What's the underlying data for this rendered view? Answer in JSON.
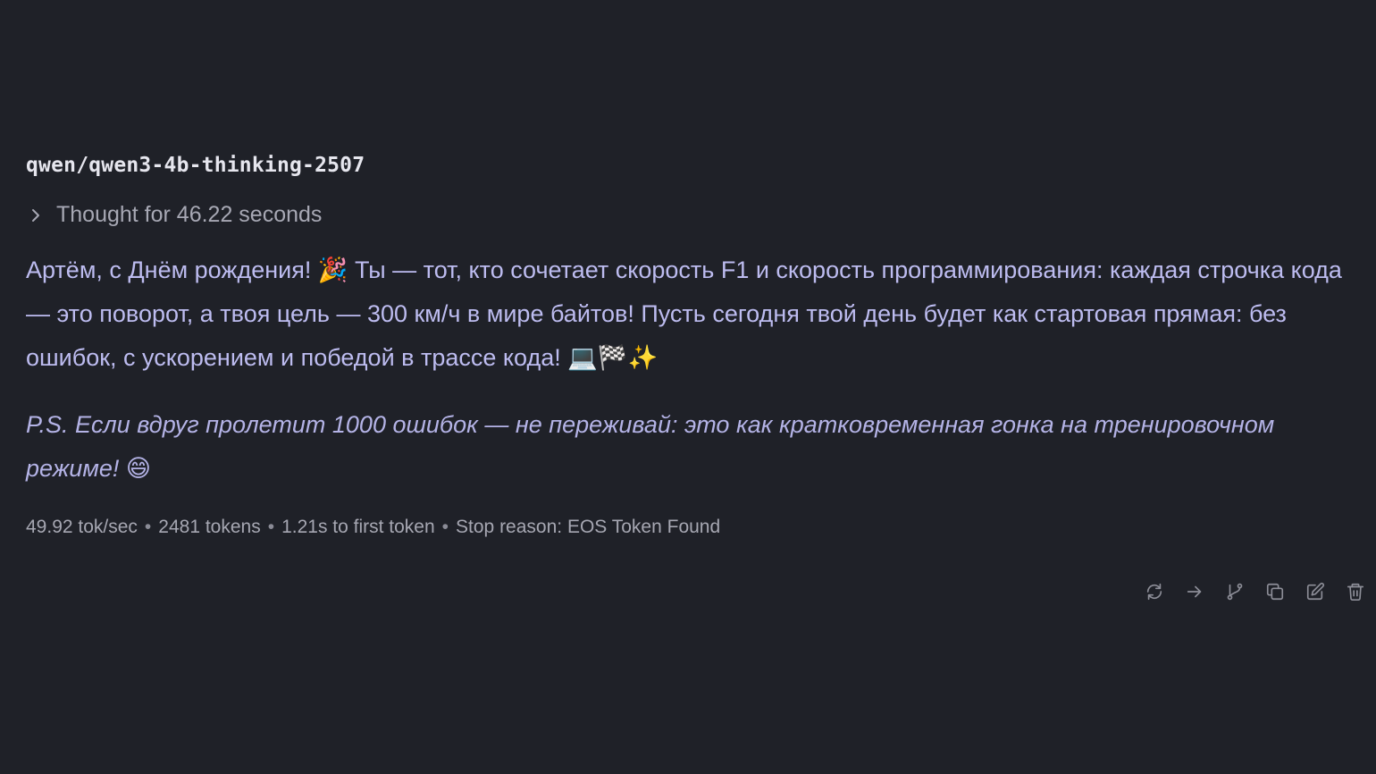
{
  "message": {
    "model_name": "qwen/qwen3-4b-thinking-2507",
    "thought_label": "Thought for 46.22 seconds",
    "body": {
      "part1": "Артём, с Днём рождения! ",
      "emoji1": "🎉",
      "part2": " Ты — тот, кто сочетает скорость F1 и скорость программирования: каждая строчка кода — это поворот, а твоя цель — 300 км/ч в мире байтов! Пусть сегодня твой день будет как стартовая прямая: без ошибок, с ускорением и победой в трассе кода! ",
      "emoji2": "💻🏁✨"
    },
    "ps": {
      "text": "P.S. Если вдруг пролетит 1000 ошибок — не переживай: это как кратковременная гонка на тренировочном режиме! ",
      "emoji": "😄"
    },
    "stats": {
      "speed": "49.92 tok/sec",
      "tokens": "2481 tokens",
      "first_token": "1.21s to first token",
      "stop_reason": "Stop reason: EOS Token Found",
      "separator": "•"
    }
  },
  "actions": [
    {
      "name": "regenerate",
      "icon": "refresh-icon"
    },
    {
      "name": "continue",
      "icon": "arrow-right-icon"
    },
    {
      "name": "branch",
      "icon": "branch-icon"
    },
    {
      "name": "copy",
      "icon": "copy-icon"
    },
    {
      "name": "edit",
      "icon": "edit-icon"
    },
    {
      "name": "delete",
      "icon": "trash-icon"
    }
  ],
  "colors": {
    "background": "#1f2128",
    "text": "#bdbcf0",
    "muted": "#a6a7b2"
  }
}
